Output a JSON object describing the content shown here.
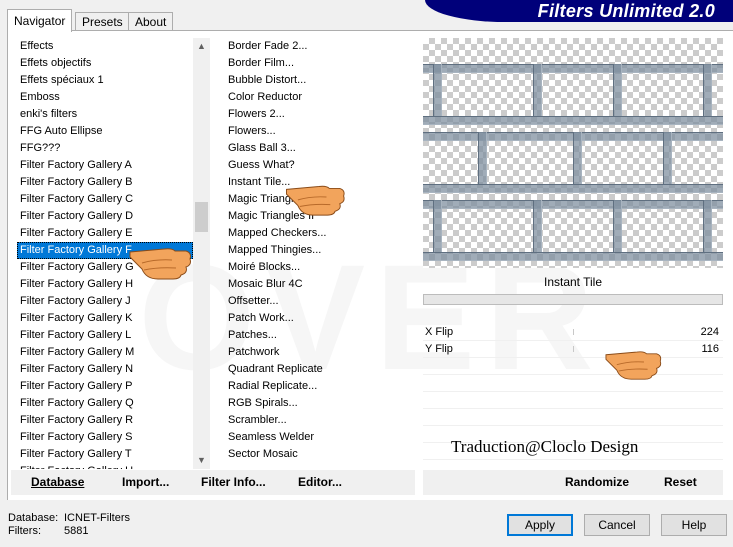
{
  "tabs": [
    "Navigator",
    "Presets",
    "About"
  ],
  "app_title": "Filters Unlimited 2.0",
  "watermark": "OVER",
  "categories": [
    "Effects",
    "Effets objectifs",
    "Effets spéciaux 1",
    "Emboss",
    "enki's filters",
    "FFG Auto Ellipse",
    "FFG???",
    "Filter Factory Gallery A",
    "Filter Factory Gallery B",
    "Filter Factory Gallery C",
    "Filter Factory Gallery D",
    "Filter Factory Gallery E",
    "Filter Factory Gallery F",
    "Filter Factory Gallery G",
    "Filter Factory Gallery H",
    "Filter Factory Gallery J",
    "Filter Factory Gallery K",
    "Filter Factory Gallery L",
    "Filter Factory Gallery M",
    "Filter Factory Gallery N",
    "Filter Factory Gallery P",
    "Filter Factory Gallery Q",
    "Filter Factory Gallery R",
    "Filter Factory Gallery S",
    "Filter Factory Gallery T",
    "Filter Factory Gallery U"
  ],
  "selected_category": "Filter Factory Gallery F",
  "filters": [
    "Border Fade 2...",
    "Border Film...",
    "Bubble Distort...",
    "Color Reductor",
    "Flowers 2...",
    "Flowers...",
    "Glass Ball 3...",
    "Guess What?",
    "Instant Tile...",
    "Magic Triangle...",
    "Magic Triangles II",
    "Mapped Checkers...",
    "Mapped Thingies...",
    "Moiré Blocks...",
    "Mosaic Blur 4C",
    "Offsetter...",
    "Patch Work...",
    "Patches...",
    "Patchwork",
    "Quadrant Replicate",
    "Radial Replicate...",
    "RGB Spirals...",
    "Scrambler...",
    "Seamless Welder",
    "Sector Mosaic"
  ],
  "selected_filter_name": "Instant Tile",
  "params": [
    {
      "label": "X Flip",
      "value": "224"
    },
    {
      "label": "Y Flip",
      "value": "116"
    }
  ],
  "credit": "Traduction@Cloclo Design",
  "left_buttons": [
    "Database",
    "Import...",
    "Filter Info...",
    "Editor..."
  ],
  "right_buttons": [
    "Randomize",
    "Reset"
  ],
  "status": {
    "database_label": "Database:",
    "database_value": "ICNET-Filters",
    "filters_label": "Filters:",
    "filters_value": "5881"
  },
  "dialog_buttons": {
    "apply": "Apply",
    "cancel": "Cancel",
    "help": "Help"
  }
}
